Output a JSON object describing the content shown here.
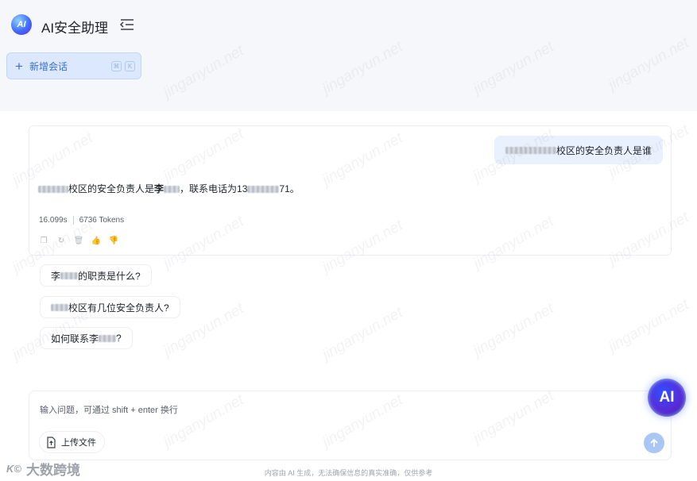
{
  "app": {
    "title": "AI安全助理",
    "logo_text": "AI"
  },
  "sidebar": {
    "new_chat_label": "新增会话",
    "shortcut_keys": [
      "⌘",
      "K"
    ]
  },
  "conversation": {
    "user_message_suffix": "校区的安全负责人是谁",
    "answer": {
      "part1": "校区的安全负责人是",
      "name": "李",
      "part2": "，联系电话为13",
      "part3": "71。"
    },
    "meta": {
      "duration": "16.099s",
      "tokens": "6736 Tokens"
    }
  },
  "suggestions": [
    {
      "prefix": "李",
      "suffix": "的职责是什么?"
    },
    {
      "prefix": "",
      "suffix": "校区有几位安全负责人?"
    },
    {
      "prefix": "如何联系李",
      "suffix": "?"
    }
  ],
  "input": {
    "placeholder": "输入问题，可通过 shift + enter 换行",
    "upload_label": "上传文件"
  },
  "floating_assistant": {
    "label": "AI"
  },
  "footer": {
    "disclaimer": "内容由 AI 生成，无法确保信息的真实准确，仅供参考",
    "brand_mark": "K©",
    "brand_name": "大数跨境"
  },
  "watermark": {
    "text": "jinganyun.net"
  }
}
